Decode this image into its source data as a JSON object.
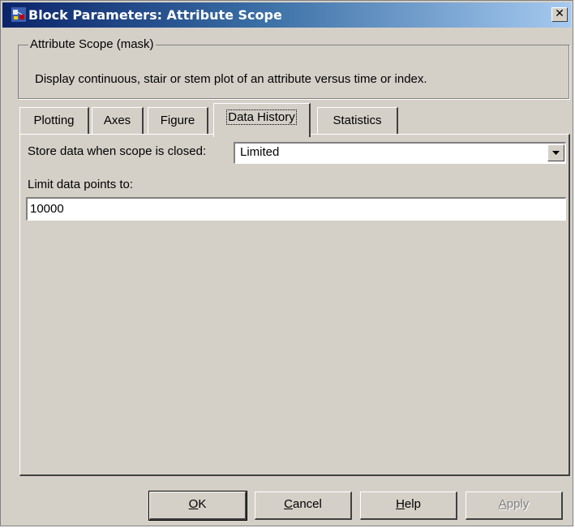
{
  "window": {
    "title": "Block Parameters: Attribute Scope",
    "close_glyph": "✕",
    "icon": "simulink-block-icon"
  },
  "mask": {
    "legend": "Attribute Scope (mask)",
    "description": "Display continuous, stair or stem plot of an attribute versus time or index."
  },
  "tabs": [
    {
      "label": "Plotting",
      "active": false
    },
    {
      "label": "Axes",
      "active": false
    },
    {
      "label": "Figure",
      "active": false
    },
    {
      "label": "Data History",
      "active": true
    },
    {
      "label": "Statistics",
      "active": false
    }
  ],
  "data_history": {
    "store_label": "Store data when scope is closed:",
    "store_value": "Limited",
    "limit_label": "Limit data points to:",
    "limit_value": "10000"
  },
  "buttons": {
    "ok": {
      "mnemonic": "O",
      "rest": "K"
    },
    "cancel": {
      "mnemonic": "C",
      "rest": "ancel"
    },
    "help": {
      "mnemonic": "H",
      "rest": "elp"
    },
    "apply": {
      "mnemonic": "A",
      "rest": "pply",
      "enabled": false
    }
  },
  "colors": {
    "dialog_face": "#d4d0c8",
    "titlebar_start": "#0a246a",
    "titlebar_end": "#a6caf0"
  }
}
